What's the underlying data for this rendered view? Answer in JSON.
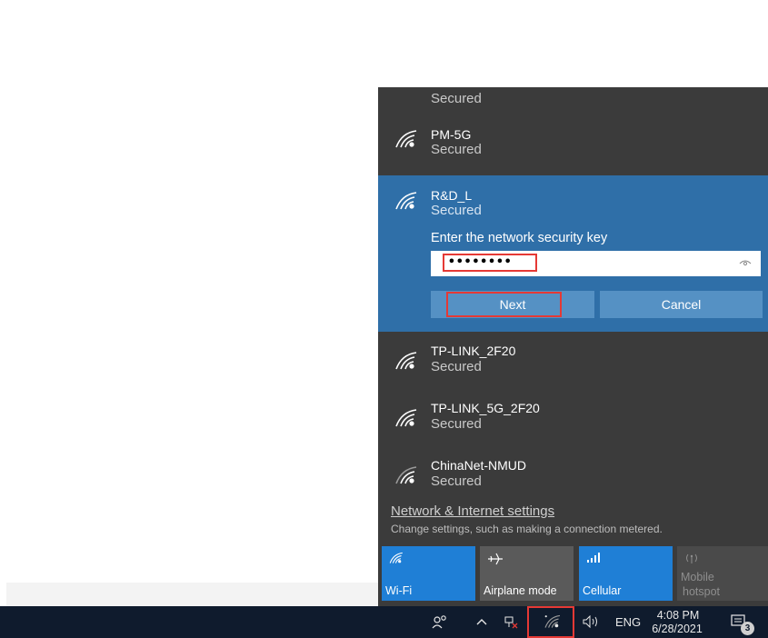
{
  "networks": [
    {
      "name": "",
      "status": "Secured"
    },
    {
      "name": "PM-5G",
      "status": "Secured"
    },
    {
      "name": "R&D_L",
      "status": "Secured"
    },
    {
      "name": "TP-LINK_2F20",
      "status": "Secured"
    },
    {
      "name": "TP-LINK_5G_2F20",
      "status": "Secured"
    },
    {
      "name": "ChinaNet-NMUD",
      "status": "Secured"
    }
  ],
  "connect": {
    "key_label": "Enter the network security key",
    "key_value": "••••••••",
    "next_label": "Next",
    "cancel_label": "Cancel"
  },
  "settings": {
    "link": "Network & Internet settings",
    "description": "Change settings, such as making a connection metered."
  },
  "tiles": [
    {
      "label": "Wi-Fi",
      "icon": "wifi-icon",
      "state": "on"
    },
    {
      "label": "Airplane mode",
      "icon": "airplane-icon",
      "state": "off"
    },
    {
      "label": "Cellular",
      "icon": "cellular-icon",
      "state": "on"
    },
    {
      "label_line1": "Mobile",
      "label_line2": "hotspot",
      "icon": "hotspot-icon",
      "state": "disabled"
    }
  ],
  "taskbar": {
    "language": "ENG",
    "time": "4:08 PM",
    "date": "6/28/2021",
    "notification_count": "3"
  },
  "colors": {
    "flyout_bg": "#3b3b3b",
    "selected_bg": "#2f6fa8",
    "accent_blue": "#1f7fd6",
    "taskbar_bg": "#0f1b2d",
    "highlight_red": "#e53935"
  }
}
